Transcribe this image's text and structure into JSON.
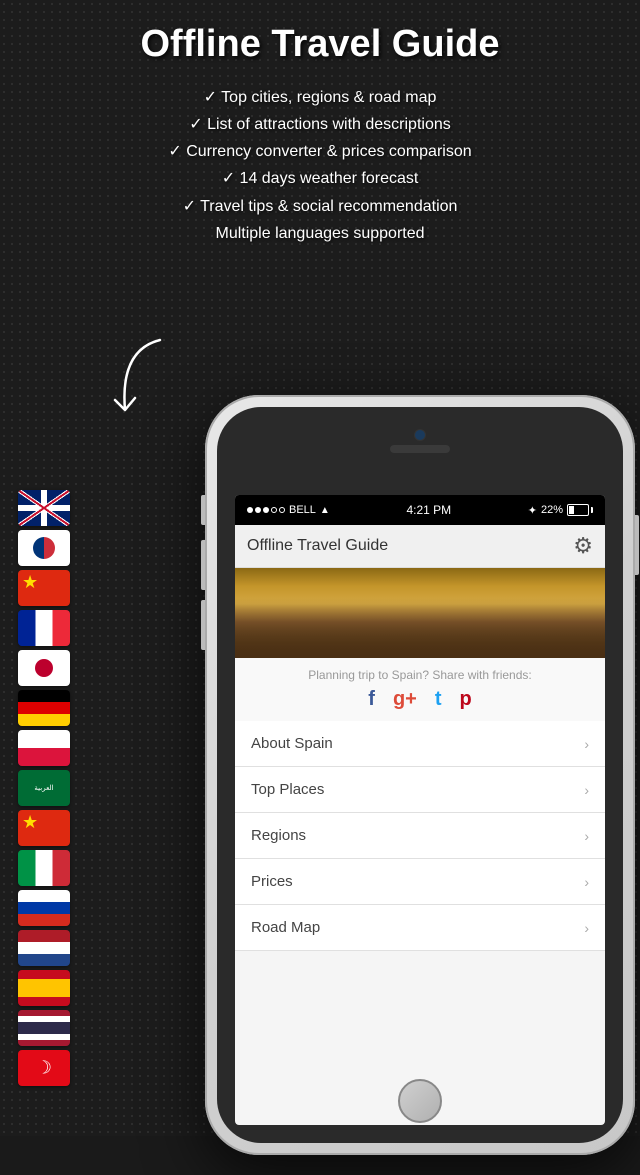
{
  "header": {
    "title": "Offline Travel Guide"
  },
  "features": [
    "✓ Top cities, regions & road map",
    "✓ List of attractions with descriptions",
    "✓ Currency converter & prices comparison",
    "✓ 14 days weather forecast",
    "✓ Travel tips & social recommendation",
    "Multiple languages supported"
  ],
  "flags": [
    {
      "id": "uk",
      "label": "English"
    },
    {
      "id": "kr",
      "label": "Korean"
    },
    {
      "id": "cn",
      "label": "Chinese"
    },
    {
      "id": "fr",
      "label": "French"
    },
    {
      "id": "jp",
      "label": "Japanese"
    },
    {
      "id": "de",
      "label": "German"
    },
    {
      "id": "pl",
      "label": "Polish"
    },
    {
      "id": "sa",
      "label": "Arabic"
    },
    {
      "id": "cn2",
      "label": "Chinese 2"
    },
    {
      "id": "it",
      "label": "Italian"
    },
    {
      "id": "ru",
      "label": "Russian"
    },
    {
      "id": "nl",
      "label": "Dutch"
    },
    {
      "id": "es",
      "label": "Spanish"
    },
    {
      "id": "th",
      "label": "Thai"
    },
    {
      "id": "tr",
      "label": "Turkish"
    }
  ],
  "phone": {
    "statusBar": {
      "carrier": "BELL",
      "time": "4:21 PM",
      "battery": "22%"
    },
    "appTitle": "Offline Travel Guide",
    "shareText": "Planning trip to Spain? Share with friends:",
    "socialIcons": {
      "facebook": "f",
      "googlePlus": "g+",
      "twitter": "t",
      "pinterest": "p"
    },
    "menuItems": [
      {
        "label": "About Spain"
      },
      {
        "label": "Top Places"
      },
      {
        "label": "Regions"
      },
      {
        "label": "Prices"
      },
      {
        "label": "Road Map"
      }
    ]
  },
  "colors": {
    "background": "#1c1c1c",
    "headerText": "#ffffff",
    "accent": "#ffffff"
  }
}
